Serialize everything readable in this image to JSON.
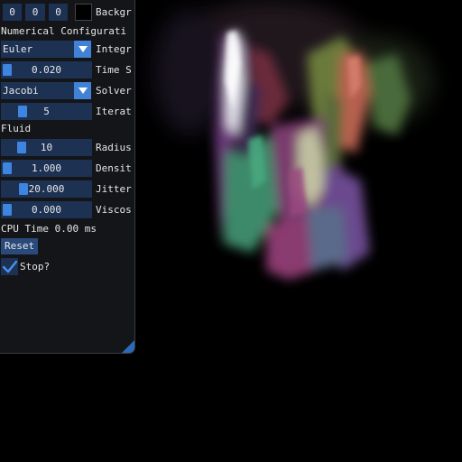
{
  "panel": {
    "background": {
      "r": "0",
      "g": "0",
      "b": "0",
      "label": "Backgr"
    },
    "numerical_header": "Numerical Configurati",
    "integrator": {
      "value": "Euler",
      "label": "Integr"
    },
    "time_step": {
      "value": "0.020",
      "label": "Time S"
    },
    "solver": {
      "value": "Jacobi",
      "label": "Solver"
    },
    "iterations": {
      "value": "5",
      "label": "Iterat"
    },
    "fluid_header": "Fluid",
    "radius": {
      "value": "10",
      "label": "Radius"
    },
    "density": {
      "value": "1.000",
      "label": "Densit"
    },
    "jitter": {
      "value": "20.000",
      "label": "Jitter"
    },
    "viscosity": {
      "value": "0.000",
      "label": "Viscos"
    },
    "cpu_time": "CPU Time 0.00 ms",
    "reset_label": "Reset",
    "stop_label": "Stop?",
    "stop_checked": true
  },
  "colors": {
    "frame_bg": "#1d3253",
    "slider_grab": "#3d85e0",
    "accent": "#4282d6"
  }
}
